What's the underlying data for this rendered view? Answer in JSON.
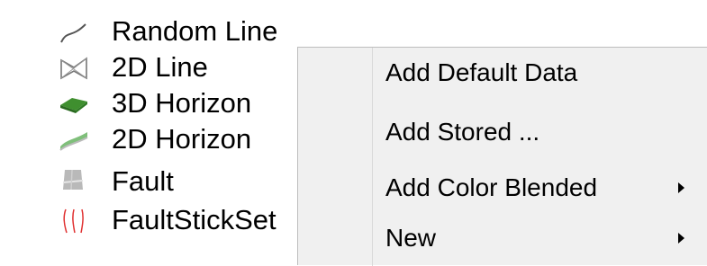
{
  "tree": {
    "items": [
      {
        "label": "Random Line",
        "icon": "random-line-icon"
      },
      {
        "label": "2D Line",
        "icon": "2d-line-icon"
      },
      {
        "label": "3D Horizon",
        "icon": "3d-horizon-icon"
      },
      {
        "label": "2D Horizon",
        "icon": "2d-horizon-icon"
      },
      {
        "label": "Fault",
        "icon": "fault-icon"
      },
      {
        "label": "FaultStickSet",
        "icon": "faultstickset-icon"
      }
    ]
  },
  "context_menu": {
    "items": [
      {
        "label": "Add Default Data",
        "has_submenu": false
      },
      {
        "label": "Add Stored ...",
        "has_submenu": false
      },
      {
        "label": "Add Color Blended",
        "has_submenu": true
      },
      {
        "label": "New",
        "has_submenu": true
      }
    ]
  },
  "colors": {
    "menu_background": "#f0f0f0",
    "horizon_3d_green": "#3f8f2f",
    "horizon_2d_green": "#7fbf7a",
    "fault_gray": "#b9b9b9",
    "faultstick_red": "#e03030"
  }
}
